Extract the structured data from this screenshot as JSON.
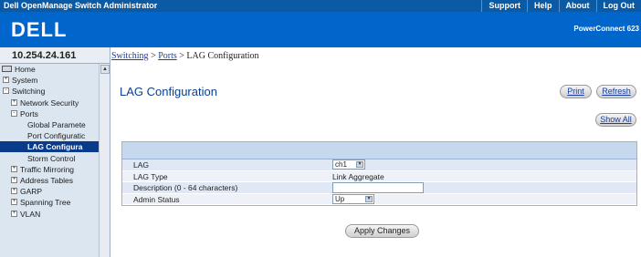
{
  "app_title": "Dell OpenManage Switch Administrator",
  "top_links": [
    "Support",
    "Help",
    "About",
    "Log Out"
  ],
  "brand": "DELL",
  "product_name": "PowerConnect 623",
  "ip_address": "10.254.24.161",
  "breadcrumb": {
    "items": [
      "Switching",
      "Ports"
    ],
    "separator": ">",
    "current": "LAG Configuration"
  },
  "sidebar": {
    "items": [
      {
        "label": "Home",
        "toggle": "",
        "icon": "home-icon"
      },
      {
        "label": "System",
        "toggle": "+"
      },
      {
        "label": "Switching",
        "toggle": "-"
      },
      {
        "label": "Network Security",
        "toggle": "+"
      },
      {
        "label": "Ports",
        "toggle": "-"
      },
      {
        "label": "Global Paramete",
        "toggle": ""
      },
      {
        "label": "Port Configuratic",
        "toggle": ""
      },
      {
        "label": "LAG Configura",
        "toggle": "",
        "selected": true
      },
      {
        "label": "Storm Control",
        "toggle": ""
      },
      {
        "label": "Traffic Mirroring",
        "toggle": "+"
      },
      {
        "label": "Address Tables",
        "toggle": "+"
      },
      {
        "label": "GARP",
        "toggle": "+"
      },
      {
        "label": "Spanning Tree",
        "toggle": "+"
      },
      {
        "label": "VLAN",
        "toggle": "+"
      }
    ]
  },
  "page": {
    "title": "LAG Configuration",
    "print_label": "Print",
    "refresh_label": "Refresh",
    "show_all_label": "Show All"
  },
  "form": {
    "lag_label": "LAG",
    "lag_value": "ch1",
    "lag_type_label": "LAG Type",
    "lag_type_value": "Link Aggregate",
    "description_label": "Description (0 - 64 characters)",
    "description_value": "",
    "admin_status_label": "Admin Status",
    "admin_status_value": "Up",
    "apply_label": "Apply Changes"
  },
  "colors": {
    "topbar": "#0b5aa6",
    "header": "#0066cc",
    "sidebar_bg": "#dce6f1",
    "selected_item": "#0a3a8a",
    "title_text": "#0b3f8e",
    "form_header": "#c6d8ee"
  }
}
